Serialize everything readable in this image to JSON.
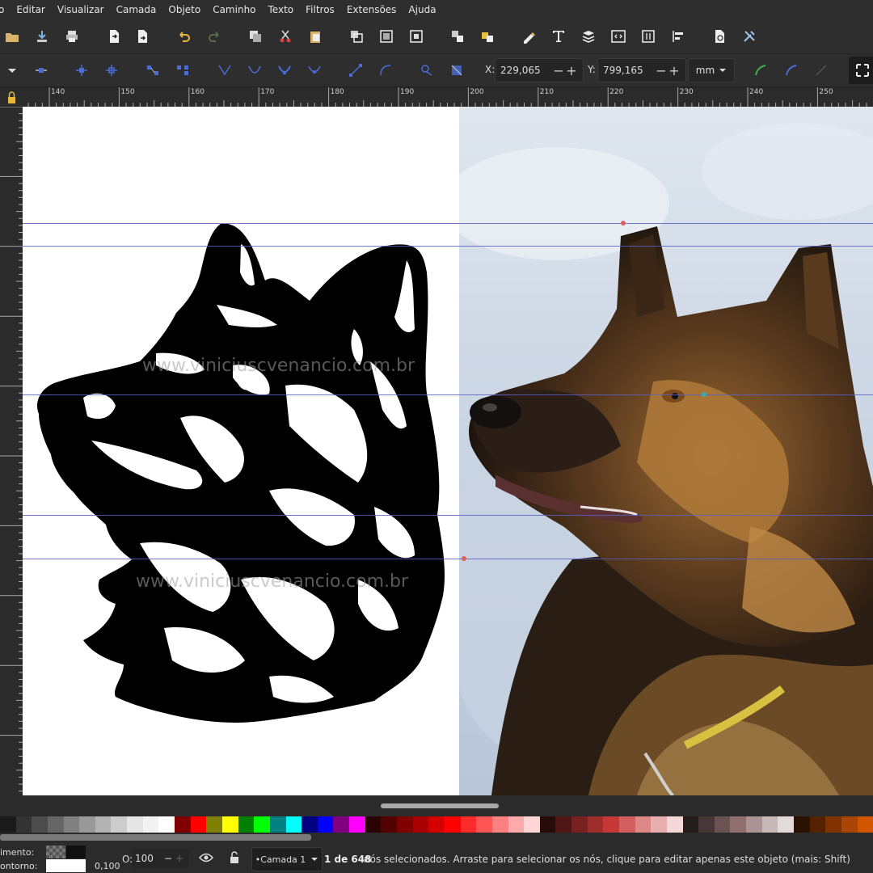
{
  "menu": [
    "o",
    "Editar",
    "Visualizar",
    "Camada",
    "Objeto",
    "Caminho",
    "Texto",
    "Filtros",
    "Extensões",
    "Ajuda"
  ],
  "toolbar_icons": [
    "open-icon",
    "save-icon",
    "print-icon",
    "import-icon",
    "export-icon",
    "undo-icon",
    "redo-icon",
    "copy-icon",
    "cut-icon",
    "paste-icon",
    "zoom-selection-icon",
    "zoom-drawing-icon",
    "zoom-page-icon",
    "duplicate-icon",
    "clone-icon",
    "group-icon",
    "ungroup-icon",
    "fill-stroke-icon",
    "text-tool-icon",
    "layers-icon",
    "xml-editor-icon",
    "objects-icon",
    "align-icon",
    "document-properties-icon",
    "preferences-icon"
  ],
  "node_controls": {
    "x_label": "X:",
    "x_value": "229,065",
    "y_label": "Y:",
    "y_value": "799,165",
    "unit": "mm"
  },
  "ruler_labels": [
    "140",
    "150",
    "160",
    "170",
    "180",
    "190",
    "200",
    "210",
    "220",
    "230",
    "240",
    "250"
  ],
  "canvas": {
    "watermark_top": "www.viniciuscvenancio.com.br",
    "watermark_bottom": "www.viniciuscvenancio.com.br"
  },
  "palette_colors": [
    "#1a1a1a",
    "#333333",
    "#4d4d4d",
    "#666666",
    "#808080",
    "#999999",
    "#b3b3b3",
    "#cccccc",
    "#e6e6e6",
    "#f2f2f2",
    "#ffffff",
    "#800000",
    "#ff0000",
    "#808000",
    "#ffff00",
    "#008000",
    "#00ff00",
    "#008080",
    "#00ffff",
    "#000080",
    "#0000ff",
    "#800080",
    "#ff00ff",
    "#2b0000",
    "#550000",
    "#800000",
    "#aa0000",
    "#d40000",
    "#ff0000",
    "#ff2a2a",
    "#ff5555",
    "#ff8080",
    "#ffaaaa",
    "#ffd5d5",
    "#280b0b",
    "#501616",
    "#782121",
    "#a02c2c",
    "#c83737",
    "#d35f5f",
    "#de8787",
    "#e9afaf",
    "#f4d7d7",
    "#241c1c",
    "#483737",
    "#6c5353",
    "#916f6f",
    "#ac9393",
    "#c8b7b7",
    "#e3dbdb",
    "#2b1100",
    "#552200",
    "#803300",
    "#aa4400",
    "#d45500"
  ],
  "status": {
    "fill_label": "imento:",
    "stroke_label": "ontorno:",
    "stroke_width": "0,100",
    "opacity_label": "O:",
    "opacity_value": "100",
    "layer": "•Camada 1",
    "selection_count": "1 de 648",
    "message": " nós selecionados. Arraste para selecionar os nós, clique para editar apenas este objeto (mais: Shift)"
  }
}
